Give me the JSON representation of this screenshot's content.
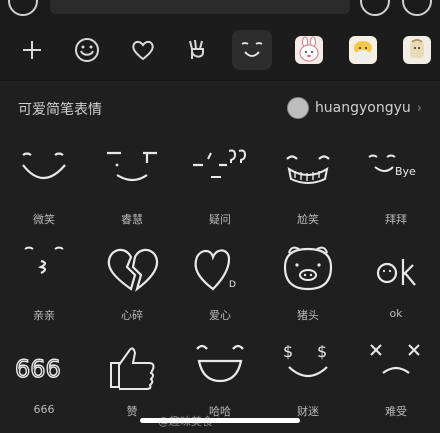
{
  "toolbar": {
    "tools": [
      {
        "name": "add-icon"
      },
      {
        "name": "emoji-smile-icon"
      },
      {
        "name": "heart-icon"
      },
      {
        "name": "hand-peace-icon"
      },
      {
        "name": "sticker-pack-doodle",
        "selected": true
      },
      {
        "name": "sticker-pack-rabbit"
      },
      {
        "name": "sticker-pack-character-1"
      },
      {
        "name": "sticker-pack-character-2"
      }
    ]
  },
  "pack": {
    "title": "可爱简笔表情",
    "author": "huangyongyu",
    "chevron": "›"
  },
  "stickers": [
    {
      "label": "微笑"
    },
    {
      "label": "睿慧"
    },
    {
      "label": "疑问"
    },
    {
      "label": "尬笑"
    },
    {
      "label": "拜拜"
    },
    {
      "label": "亲亲"
    },
    {
      "label": "心碎"
    },
    {
      "label": "爱心"
    },
    {
      "label": "猪头"
    },
    {
      "label": "ok"
    },
    {
      "label": "666"
    },
    {
      "label": "赞"
    },
    {
      "label": "哈哈"
    },
    {
      "label": "财迷"
    },
    {
      "label": "难受"
    }
  ],
  "watermark": "@趣味美食"
}
